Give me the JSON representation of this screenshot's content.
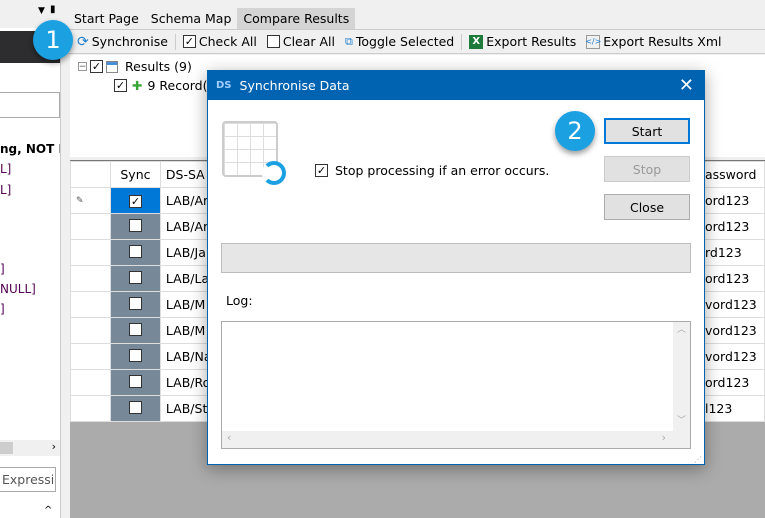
{
  "left_panel": {
    "lines": [
      "ng, NOT I",
      "L]",
      "L]",
      "]",
      "NULL]",
      "]"
    ],
    "expression_button": "Expression"
  },
  "tabs": [
    {
      "label": "Start Page"
    },
    {
      "label": "Schema Map"
    },
    {
      "label": "Compare Results",
      "active": true
    }
  ],
  "toolbar": {
    "synchronise": "Synchronise",
    "check_all": "Check All",
    "clear_all": "Clear All",
    "toggle_selected": "Toggle Selected",
    "export_results": "Export Results",
    "export_results_xml": "Export Results Xml"
  },
  "tree": {
    "root": "Results (9)",
    "child": "9 Record("
  },
  "grid": {
    "headers": [
      "Sync",
      "DS-SA",
      "assword"
    ],
    "rows": [
      {
        "name": "LAB/Ar",
        "pw": "ord123",
        "checked": true
      },
      {
        "name": "LAB/Ar",
        "pw": "ord123"
      },
      {
        "name": "LAB/Ja",
        "pw": "rd123"
      },
      {
        "name": "LAB/La",
        "pw": "ord123"
      },
      {
        "name": "LAB/M",
        "pw": "vord123"
      },
      {
        "name": "LAB/M",
        "pw": "vord123"
      },
      {
        "name": "LAB/Na",
        "pw": "vord123"
      },
      {
        "name": "LAB/Ro",
        "pw": "ord123"
      },
      {
        "name": "LAB/St",
        "pw": "l123"
      }
    ]
  },
  "dialog": {
    "title": "Synchronise Data",
    "stop_on_error": "Stop processing if an error occurs.",
    "stop_on_error_checked": true,
    "start": "Start",
    "stop": "Stop",
    "close": "Close",
    "log_label": "Log:",
    "progress": 0
  },
  "badges": {
    "one": "1",
    "two": "2"
  },
  "colors": {
    "accent": "#0063b1",
    "badge": "#1ba1e2",
    "sync_col": "#778899"
  }
}
